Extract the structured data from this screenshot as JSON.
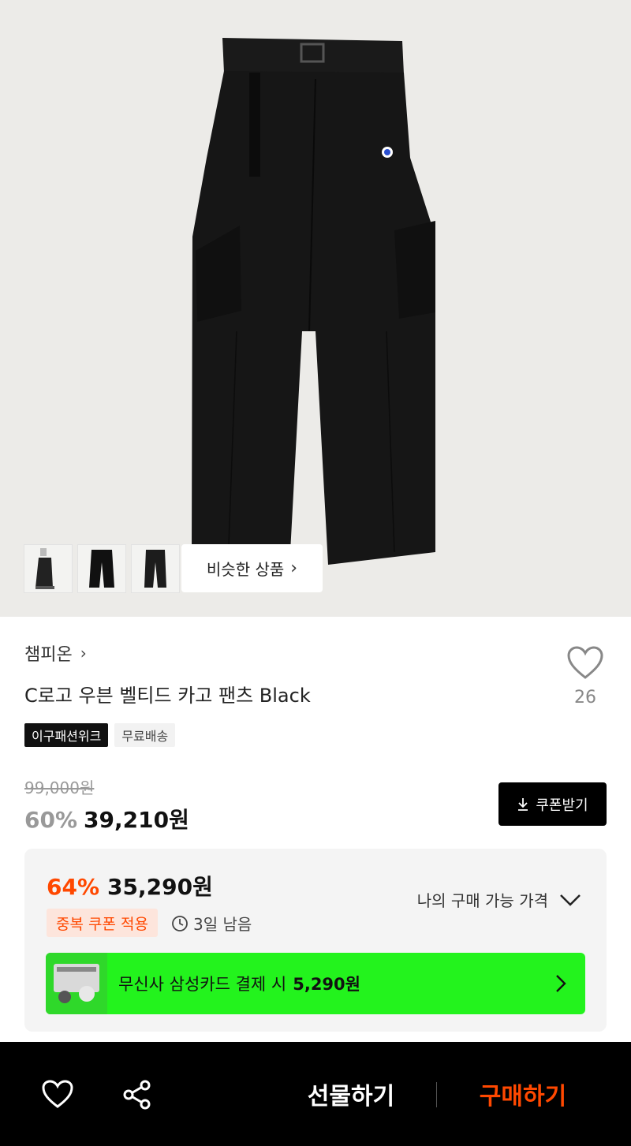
{
  "gallery": {
    "main_image": "black-cargo-pants-photo",
    "thumbnails": [
      "model-wearing-pants",
      "pants-front",
      "pants-flat"
    ],
    "similar_label": "비슷한 상품"
  },
  "product": {
    "brand": "챔피온",
    "name": "C로고 우븐 벨티드 카고 팬츠 Black",
    "like_count": "26",
    "tags": [
      "이구패션위크",
      "무료배송"
    ]
  },
  "pricing": {
    "original_price": "99,000원",
    "sale_rate": "60%",
    "sale_price": "39,210원",
    "coupon_button": "쿠폰받기"
  },
  "benefit": {
    "best_rate": "64%",
    "best_price": "35,290원",
    "my_price_label": "나의 구매 가능 가격",
    "dup_coupon_label": "중복 쿠폰 적용",
    "time_left": "3일 남음",
    "card_text": "무신사 삼성카드 결제 시",
    "card_amount": "5,290원"
  },
  "bottom_bar": {
    "gift_label": "선물하기",
    "buy_label": "구매하기"
  },
  "colors": {
    "accent": "#ff4800",
    "banner_green": "#23f31d",
    "hero_bg": "#ecebe8"
  }
}
